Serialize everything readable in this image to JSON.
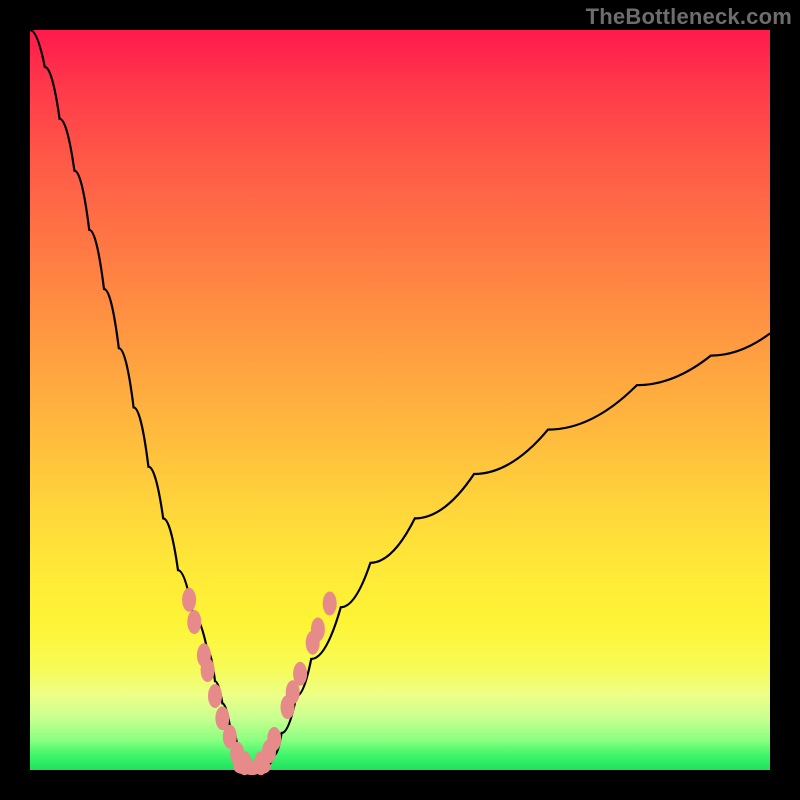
{
  "watermark": {
    "text": "TheBottleneck.com"
  },
  "colors": {
    "frame": "#000000",
    "curve": "#000000",
    "marker_fill": "#e78a8a",
    "marker_stroke": "#d46e6e",
    "gradient_top": "#ff1a4d",
    "gradient_bottom": "#1ee05e"
  },
  "chart_data": {
    "type": "line",
    "title": "",
    "xlabel": "",
    "ylabel": "",
    "x": [
      0,
      2,
      4,
      6,
      8,
      10,
      12,
      14,
      16,
      18,
      20,
      22,
      24,
      25,
      26,
      27,
      28,
      29,
      30,
      31,
      32,
      33,
      34,
      36,
      38,
      42,
      46,
      52,
      60,
      70,
      82,
      92,
      100
    ],
    "values": [
      100,
      95,
      88,
      81,
      73,
      65,
      57,
      49,
      41,
      34,
      27,
      21,
      16,
      12,
      9,
      6,
      3.5,
      1.5,
      0.6,
      0.3,
      0.6,
      2,
      5,
      10,
      15,
      22,
      28,
      34,
      40,
      46,
      52,
      56,
      59
    ],
    "xlim": [
      0,
      100
    ],
    "ylim": [
      0,
      100
    ],
    "markers": {
      "left_branch": [
        {
          "x": 21.5,
          "y": 23
        },
        {
          "x": 22.2,
          "y": 20
        },
        {
          "x": 23.5,
          "y": 15.5
        },
        {
          "x": 24.0,
          "y": 13.5
        },
        {
          "x": 25.0,
          "y": 10
        },
        {
          "x": 26.0,
          "y": 7
        },
        {
          "x": 27.0,
          "y": 4.5
        },
        {
          "x": 28.0,
          "y": 2.2
        },
        {
          "x": 29.0,
          "y": 0.9
        }
      ],
      "right_branch": [
        {
          "x": 31.2,
          "y": 0.9
        },
        {
          "x": 32.3,
          "y": 2.5
        },
        {
          "x": 33.0,
          "y": 4.2
        },
        {
          "x": 34.8,
          "y": 8.5
        },
        {
          "x": 35.5,
          "y": 10.5
        },
        {
          "x": 36.5,
          "y": 13
        },
        {
          "x": 38.2,
          "y": 17.2
        },
        {
          "x": 38.9,
          "y": 19
        },
        {
          "x": 40.5,
          "y": 22.5
        }
      ],
      "bottom": [
        {
          "x": 28.8,
          "y": 0.4
        },
        {
          "x": 30.0,
          "y": 0.25
        },
        {
          "x": 31.2,
          "y": 0.4
        }
      ]
    }
  }
}
